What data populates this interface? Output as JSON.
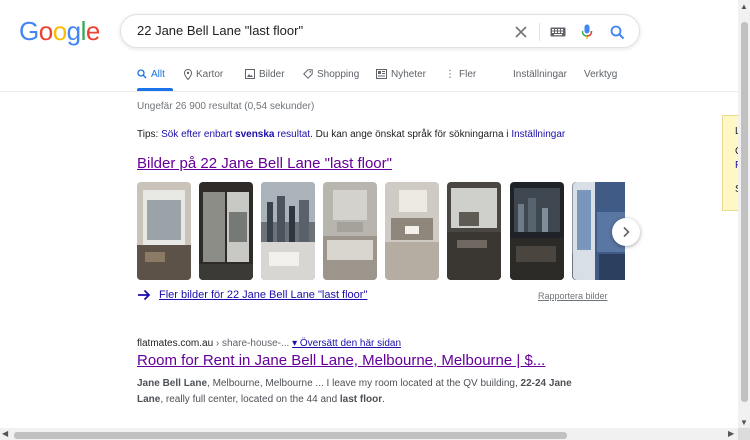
{
  "logo": {
    "letters": [
      "G",
      "o",
      "o",
      "g",
      "l",
      "e"
    ],
    "colors": [
      "#4285f4",
      "#ea4335",
      "#fbbc05",
      "#4285f4",
      "#34a853",
      "#ea4335"
    ]
  },
  "search": {
    "query": "22 Jane Bell Lane \"last floor\""
  },
  "tabs": {
    "all": "Allt",
    "maps": "Kartor",
    "images": "Bilder",
    "shopping": "Shopping",
    "news": "Nyheter",
    "more": "Fler",
    "settings": "Inställningar",
    "tools": "Verktyg"
  },
  "stats": "Ungefär 26 900 resultat (0,54 sekunder)",
  "tip": {
    "prefix": "Tips: ",
    "link_a": "Sök efter enbart",
    "link_bold": "svenska",
    "link_b": "resultat",
    "middle": ". Du kan ange önskat språk för sökningarna i ",
    "settings_link": "Inställningar"
  },
  "images": {
    "heading": "Bilder på 22 Jane Bell Lane \"last floor\"",
    "more_link": "Fler bilder för 22 Jane Bell Lane \"last floor\"",
    "report": "Rapportera bilder"
  },
  "result": {
    "domain": "flatmates.com.au",
    "path": " › share-house-...",
    "translate": "▾ Översätt den här sidan",
    "title": "Room for Rent in Jane Bell Lane, Melbourne, Melbourne | $...",
    "snippet_parts": [
      {
        "b": "Jane Bell Lane"
      },
      {
        "t": ", Melbourne, Melbourne ... I leave my room located at the QV building, "
      },
      {
        "b": "22-24"
      },
      {
        "t": " "
      },
      {
        "b": "Jane Lane"
      },
      {
        "t": ", really full center, located on the 44 and "
      },
      {
        "b": "last floor"
      },
      {
        "t": "."
      }
    ]
  },
  "side_card": {
    "lines": [
      "L",
      "C",
      "F",
      "S"
    ]
  }
}
